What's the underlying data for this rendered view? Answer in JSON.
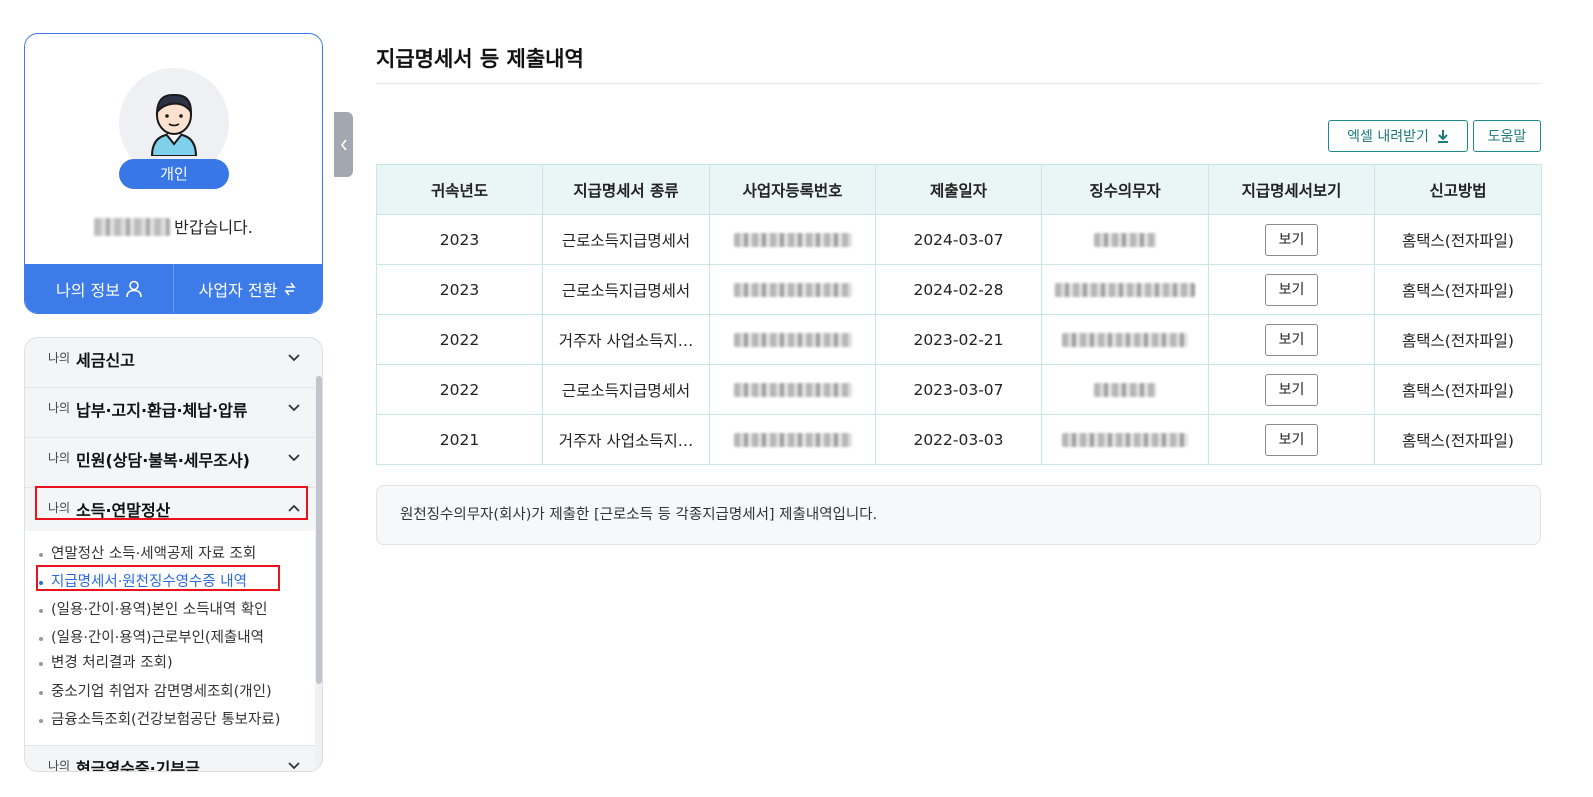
{
  "profile": {
    "badge": "개인",
    "greeting": "반갑습니다.",
    "my_info_label": "나의 정보",
    "switch_label": "사업자 전환"
  },
  "menu": {
    "prefix": "나의",
    "sections": [
      {
        "title": "세금신고"
      },
      {
        "title": "납부·고지·환급·체납·압류"
      },
      {
        "title": "민원(상담·불복·세무조사)"
      },
      {
        "title": "소득·연말정산"
      },
      {
        "title": "현금영수증·기부금"
      }
    ],
    "sub_items": [
      {
        "label": "연말정산 소득·세액공제 자료 조회"
      },
      {
        "label": "지급명세서·원천징수영수증 내역"
      },
      {
        "label": "(일용·간이·용역)본인 소득내역 확인"
      },
      {
        "label": "(일용·간이·용역)근로부인(제출내역"
      },
      {
        "label": "변경 처리결과 조회)"
      },
      {
        "label": "중소기업 취업자 감면명세조회(개인)"
      },
      {
        "label": "금융소득조회(건강보험공단 통보자료)"
      }
    ]
  },
  "main": {
    "title": "지급명세서 등 제출내역",
    "excel_label": "엑셀 내려받기",
    "help_label": "도움말",
    "columns": [
      "귀속년도",
      "지급명세서 종류",
      "사업자등록번호",
      "제출일자",
      "징수의무자",
      "지급명세서보기",
      "신고방법"
    ],
    "rows": [
      {
        "year": "2023",
        "type": "근로소득지급명세서",
        "date": "2024-03-07",
        "view": "보기",
        "method": "홈택스(전자파일)"
      },
      {
        "year": "2023",
        "type": "근로소득지급명세서",
        "date": "2024-02-28",
        "view": "보기",
        "method": "홈택스(전자파일)"
      },
      {
        "year": "2022",
        "type": "거주자 사업소득지…",
        "date": "2023-02-21",
        "view": "보기",
        "method": "홈택스(전자파일)"
      },
      {
        "year": "2022",
        "type": "근로소득지급명세서",
        "date": "2023-03-07",
        "view": "보기",
        "method": "홈택스(전자파일)"
      },
      {
        "year": "2021",
        "type": "거주자 사업소득지…",
        "date": "2022-03-03",
        "view": "보기",
        "method": "홈택스(전자파일)"
      }
    ],
    "notice": "원천징수의무자(회사)가 제출한 [근로소득 등 각종지급명세서] 제출내역입니다."
  },
  "colors": {
    "accent_blue": "#3d7be8",
    "teal": "#1d8a8a",
    "highlight_red": "#e8131d"
  }
}
